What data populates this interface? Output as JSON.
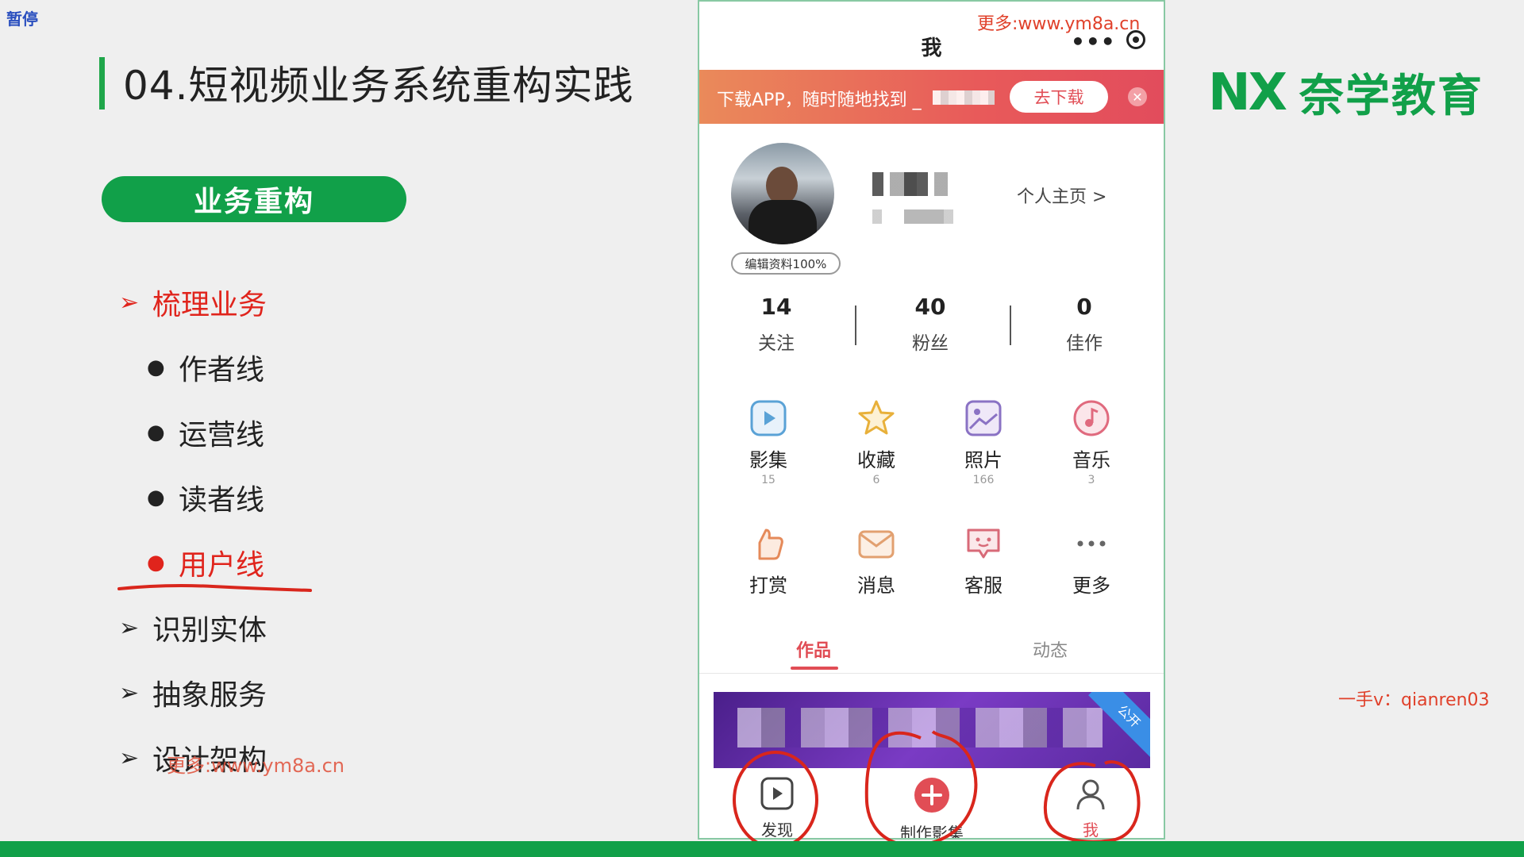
{
  "overlay": {
    "pause_label": "暂停"
  },
  "slide": {
    "title": "04.短视频业务系统重构实践",
    "section_pill": "业务重构",
    "outline": [
      {
        "marker": "➢",
        "text": "梳理业务",
        "level": 1,
        "highlight": true
      },
      {
        "marker": "●",
        "text": "作者线",
        "level": 2,
        "highlight": false
      },
      {
        "marker": "●",
        "text": "运营线",
        "level": 2,
        "highlight": false
      },
      {
        "marker": "●",
        "text": "读者线",
        "level": 2,
        "highlight": false
      },
      {
        "marker": "●",
        "text": "用户线",
        "level": 2,
        "highlight": true
      },
      {
        "marker": "➢",
        "text": "识别实体",
        "level": 1,
        "highlight": false
      },
      {
        "marker": "➢",
        "text": "抽象服务",
        "level": 1,
        "highlight": false
      },
      {
        "marker": "➢",
        "text": "设计架构",
        "level": 1,
        "highlight": false
      }
    ],
    "watermark_left": "更多:www.ym8a.cn",
    "watermark_right": "一手v：qianren03",
    "logo_mark": "NX",
    "logo_text": "奈学教育"
  },
  "phone": {
    "watermark_top": "更多:www.ym8a.cn",
    "header_title": "我",
    "header_more": "•••",
    "banner": {
      "text": "下载APP，随时随地找到 _",
      "button": "去下载",
      "close": "✕"
    },
    "profile": {
      "edit_badge": "编辑资料100%",
      "homepage_link": "个人主页 >"
    },
    "stats": [
      {
        "value": "14",
        "label": "关注"
      },
      {
        "value": "40",
        "label": "粉丝"
      },
      {
        "value": "0",
        "label": "佳作"
      }
    ],
    "grid_row1": [
      {
        "icon": "video-album-icon",
        "label": "影集",
        "count": "15"
      },
      {
        "icon": "star-icon",
        "label": "收藏",
        "count": "6"
      },
      {
        "icon": "photo-icon",
        "label": "照片",
        "count": "166"
      },
      {
        "icon": "music-icon",
        "label": "音乐",
        "count": "3"
      }
    ],
    "grid_row2": [
      {
        "icon": "thumb-up-icon",
        "label": "打赏"
      },
      {
        "icon": "mail-icon",
        "label": "消息"
      },
      {
        "icon": "chat-icon",
        "label": "客服"
      },
      {
        "icon": "more-icon",
        "label": "更多"
      }
    ],
    "tabs": [
      {
        "label": "作品",
        "active": true
      },
      {
        "label": "动态",
        "active": false
      }
    ],
    "thumb_badge": "公开",
    "tabbar": [
      {
        "icon": "play-icon",
        "label": "发现"
      },
      {
        "icon": "plus-icon",
        "label": "制作影集"
      },
      {
        "icon": "person-icon",
        "label": "我"
      }
    ]
  },
  "colors": {
    "brand_green": "#11a049",
    "accent_red": "#e14d55",
    "ink_red": "#d9261c"
  }
}
